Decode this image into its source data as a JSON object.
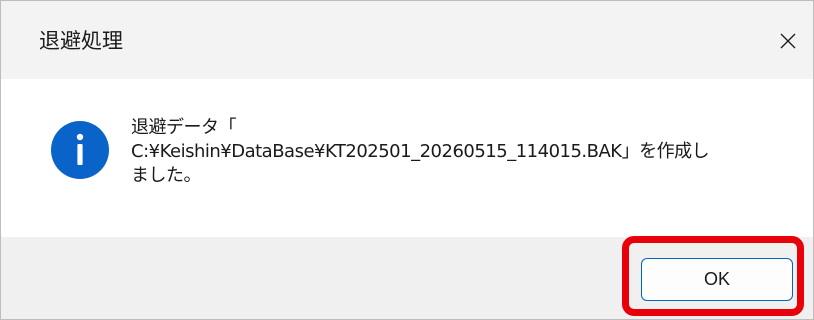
{
  "window": {
    "title": "退避処理",
    "close_icon": "close-icon"
  },
  "message": {
    "icon": "info-icon",
    "lines": [
      "退避データ「",
      "C:¥Keishin¥DataBase¥KT202501_20260515_114015.BAK」を作成し",
      "ました。"
    ]
  },
  "footer": {
    "ok_label": "OK"
  },
  "colors": {
    "accent": "#0067c0",
    "info_icon": "#0a63c9",
    "highlight": "#e8000b",
    "titlebar_bg": "#f3f3f3",
    "footer_bg": "#f0f0f0"
  }
}
